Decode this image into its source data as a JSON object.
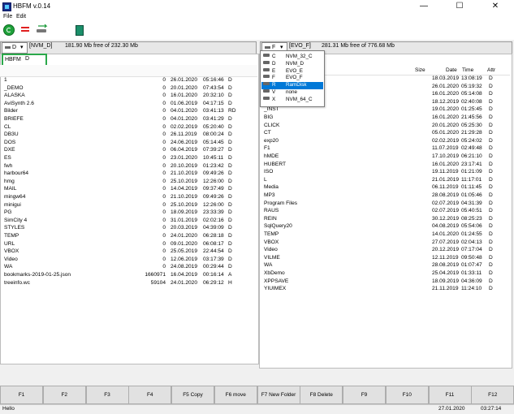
{
  "window": {
    "title": "HBFM v.0.14",
    "min": "—",
    "max": "☐",
    "close": "✕"
  },
  "menu": {
    "file": "File",
    "edit": "Edit"
  },
  "left": {
    "drive": "D",
    "path": "[NVM_D]",
    "free": "181.90 Mb free of 232.30 Mb",
    "search_label": "HBFM",
    "search_value": "D",
    "rows": [
      {
        "name": "1",
        "size": "0",
        "date": "26.01.2020",
        "time": "05:16:46",
        "attr": "D"
      },
      {
        "name": "_DEMO",
        "size": "0",
        "date": "20.01.2020",
        "time": "07:43:54",
        "attr": "D"
      },
      {
        "name": "ALASKA",
        "size": "0",
        "date": "16.01.2020",
        "time": "20:32:10",
        "attr": "D"
      },
      {
        "name": "AviSynth 2.6",
        "size": "0",
        "date": "01.06.2019",
        "time": "04:17:15",
        "attr": "D"
      },
      {
        "name": "Bilder",
        "size": "0",
        "date": "04.01.2020",
        "time": "03:41:13",
        "attr": "RD"
      },
      {
        "name": "BRIEFE",
        "size": "0",
        "date": "04.01.2020",
        "time": "03:41:29",
        "attr": "D"
      },
      {
        "name": "CL",
        "size": "0",
        "date": "02.02.2019",
        "time": "05:20:40",
        "attr": "D"
      },
      {
        "name": "DB3U",
        "size": "0",
        "date": "26.11.2019",
        "time": "08:00:24",
        "attr": "D"
      },
      {
        "name": "DOS",
        "size": "0",
        "date": "24.06.2019",
        "time": "05:14:45",
        "attr": "D"
      },
      {
        "name": "DXE",
        "size": "0",
        "date": "06.04.2019",
        "time": "07:39:27",
        "attr": "D"
      },
      {
        "name": "ES",
        "size": "0",
        "date": "23.01.2020",
        "time": "10:45:11",
        "attr": "D"
      },
      {
        "name": "fwh",
        "size": "0",
        "date": "20.10.2019",
        "time": "01:23:42",
        "attr": "D"
      },
      {
        "name": "harbour64",
        "size": "0",
        "date": "21.10.2019",
        "time": "09:49:26",
        "attr": "D"
      },
      {
        "name": "hmg",
        "size": "0",
        "date": "25.10.2019",
        "time": "12:26:00",
        "attr": "D"
      },
      {
        "name": "MAIL",
        "size": "0",
        "date": "14.04.2019",
        "time": "09:37:49",
        "attr": "D"
      },
      {
        "name": "mingw64",
        "size": "0",
        "date": "21.10.2019",
        "time": "09:49:26",
        "attr": "D"
      },
      {
        "name": "minigui",
        "size": "0",
        "date": "25.10.2019",
        "time": "12:26:00",
        "attr": "D"
      },
      {
        "name": "PG",
        "size": "0",
        "date": "18.09.2019",
        "time": "23:33:39",
        "attr": "D"
      },
      {
        "name": "SimCity 4",
        "size": "0",
        "date": "31.01.2019",
        "time": "02:02:16",
        "attr": "D"
      },
      {
        "name": "STYLES",
        "size": "0",
        "date": "20.03.2019",
        "time": "04:39:09",
        "attr": "D"
      },
      {
        "name": "TEMP",
        "size": "0",
        "date": "24.01.2020",
        "time": "06:28:18",
        "attr": "D"
      },
      {
        "name": "URL",
        "size": "0",
        "date": "09.01.2020",
        "time": "06:08:17",
        "attr": "D"
      },
      {
        "name": "VBOX",
        "size": "0",
        "date": "25.05.2019",
        "time": "22:44:54",
        "attr": "D"
      },
      {
        "name": "Video",
        "size": "0",
        "date": "12.06.2019",
        "time": "03:17:39",
        "attr": "D"
      },
      {
        "name": "WA",
        "size": "0",
        "date": "24.08.2019",
        "time": "00:29:44",
        "attr": "D"
      },
      {
        "name": "bookmarks-2019-01-25.json",
        "size": "1660971",
        "date": "16.04.2019",
        "time": "00:16:14",
        "attr": "A"
      },
      {
        "name": "treeinfo.wc",
        "size": "59104",
        "date": "24.01.2020",
        "time": "06:29:12",
        "attr": "H"
      }
    ]
  },
  "right": {
    "drive": "F",
    "path": "[EVO_F]",
    "free": "281.31 Mb free of 776.68 Mb",
    "headers": {
      "size": "Size",
      "date": "Date",
      "time": "Time",
      "attr": "Attr"
    },
    "rows": [
      {
        "name": "",
        "date": "18.03.2019",
        "time": "13:08:19",
        "attr": "D"
      },
      {
        "name": "",
        "date": "26.01.2020",
        "time": "05:19:32",
        "attr": "D"
      },
      {
        "name": "",
        "date": "16.01.2020",
        "time": "05:14:08",
        "attr": "D"
      },
      {
        "name": "",
        "date": "18.12.2019",
        "time": "02:40:08",
        "attr": "D"
      },
      {
        "name": "_INST",
        "date": "19.01.2020",
        "time": "01:25:45",
        "attr": "D"
      },
      {
        "name": "BIG",
        "date": "16.01.2020",
        "time": "21:45:56",
        "attr": "D"
      },
      {
        "name": "CLICK",
        "date": "20.01.2020",
        "time": "05:25:30",
        "attr": "D"
      },
      {
        "name": "CT",
        "date": "05.01.2020",
        "time": "21:29:28",
        "attr": "D"
      },
      {
        "name": "exp20",
        "date": "02.02.2019",
        "time": "05:24:02",
        "attr": "D"
      },
      {
        "name": "F1",
        "date": "11.07.2019",
        "time": "02:49:48",
        "attr": "D"
      },
      {
        "name": "hMDE",
        "date": "17.10.2019",
        "time": "06:21:10",
        "attr": "D"
      },
      {
        "name": "HUBERT",
        "date": "16.01.2020",
        "time": "23:17:41",
        "attr": "D"
      },
      {
        "name": "ISO",
        "date": "19.11.2019",
        "time": "01:21:09",
        "attr": "D"
      },
      {
        "name": "L",
        "date": "21.01.2019",
        "time": "11:17:01",
        "attr": "D"
      },
      {
        "name": "Media",
        "date": "06.11.2019",
        "time": "01:11:45",
        "attr": "D"
      },
      {
        "name": "MP3",
        "date": "28.08.2019",
        "time": "01:05:46",
        "attr": "D"
      },
      {
        "name": "Program Files",
        "date": "02.07.2019",
        "time": "04:31:39",
        "attr": "D"
      },
      {
        "name": "RAUS",
        "date": "02.07.2019",
        "time": "05:40:51",
        "attr": "D"
      },
      {
        "name": "REIN",
        "date": "30.12.2019",
        "time": "08:25:23",
        "attr": "D"
      },
      {
        "name": "SqlQuery20",
        "date": "04.08.2019",
        "time": "05:54:06",
        "attr": "D"
      },
      {
        "name": "TEMP",
        "date": "14.01.2020",
        "time": "01:24:55",
        "attr": "D"
      },
      {
        "name": "VBOX",
        "date": "27.07.2019",
        "time": "02:04:13",
        "attr": "D"
      },
      {
        "name": "Video",
        "date": "20.12.2019",
        "time": "07:17:04",
        "attr": "D"
      },
      {
        "name": "VILME",
        "date": "12.11.2019",
        "time": "09:50:48",
        "attr": "D"
      },
      {
        "name": "WA",
        "date": "28.08.2019",
        "time": "01:07:47",
        "attr": "D"
      },
      {
        "name": "XbDemo",
        "date": "25.04.2019",
        "time": "01:33:11",
        "attr": "D"
      },
      {
        "name": "XPPSAVE",
        "date": "18.09.2019",
        "time": "04:36:09",
        "attr": "D"
      },
      {
        "name": "YIUIMEX",
        "date": "21.11.2019",
        "time": "11:24:10",
        "attr": "D"
      }
    ]
  },
  "dropdown": [
    {
      "letter": "C",
      "label": "NVM_32_C",
      "selected": false
    },
    {
      "letter": "D",
      "label": "NVM_D",
      "selected": false
    },
    {
      "letter": "E",
      "label": "EVO_E",
      "selected": false
    },
    {
      "letter": "F",
      "label": "EVO_F",
      "selected": false
    },
    {
      "letter": "R",
      "label": "RamDisk",
      "selected": true
    },
    {
      "letter": "V",
      "label": "none",
      "selected": false
    },
    {
      "letter": "X",
      "label": "NVM_64_C",
      "selected": false
    }
  ],
  "fkeys": [
    "F1",
    "F2",
    "F3",
    "F4",
    "F5 Copy",
    "F6 move",
    "F7 New Folder",
    "F8 Delete",
    "F9",
    "F10",
    "F11",
    "F12"
  ],
  "status": {
    "message": "Hello",
    "date": "27.01.2020",
    "time": "03:27:14"
  },
  "icons": {
    "drive": "▾",
    "check": "✓"
  },
  "colors": {
    "accent": "#0078d7",
    "search_border": "#2aa84a",
    "refresh": "#1ea13a",
    "compare": "#e02020"
  }
}
